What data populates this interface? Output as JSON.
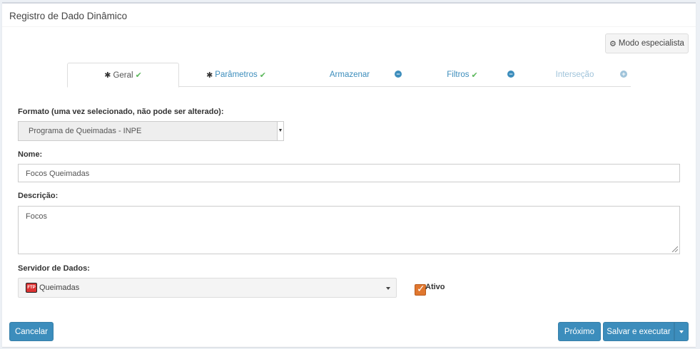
{
  "header": {
    "title": "Registro de Dado Dinâmico"
  },
  "toolbar": {
    "expert_label": "Modo especialista"
  },
  "tabs": [
    {
      "label": "Geral"
    },
    {
      "label": "Parâmetros"
    },
    {
      "label": "Armazenar"
    },
    {
      "label": "Filtros"
    },
    {
      "label": "Interseção"
    }
  ],
  "form": {
    "format_label": "Formato (uma vez selecionado, não pode ser alterado):",
    "format_value": "Programa de Queimadas - INPE",
    "name_label": "Nome:",
    "name_value": "Focos Queimadas",
    "description_label": "Descrição:",
    "description_value": "Focos",
    "server_label": "Servidor de Dados:",
    "server_value": "Queimadas",
    "server_icon_text": "FTP",
    "active_label": "Ativo"
  },
  "footer": {
    "cancel_label": "Cancelar",
    "next_label": "Próximo",
    "save_run_label": "Salvar e executar"
  },
  "colors": {
    "primary": "#3c8dbc",
    "checkbox": "#e0772f",
    "success": "#5cb85c"
  }
}
